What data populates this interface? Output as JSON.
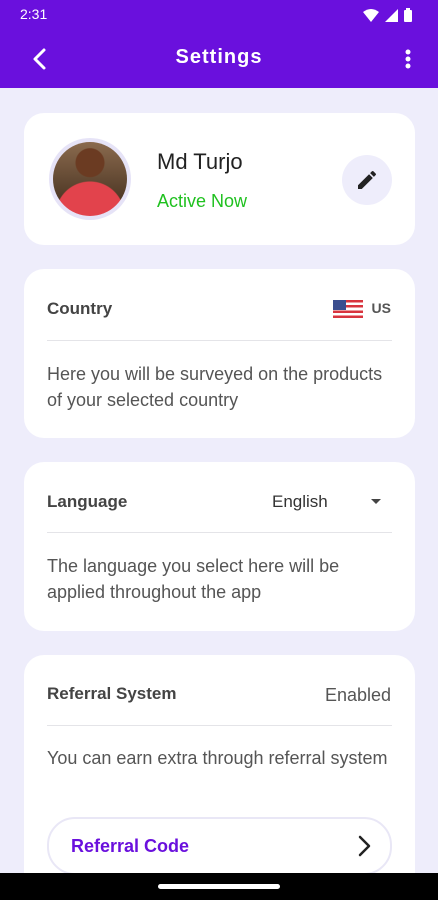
{
  "status_bar": {
    "time": "2:31"
  },
  "app_bar": {
    "title": "Settings"
  },
  "profile": {
    "name": "Md Turjo",
    "status": "Active Now"
  },
  "country": {
    "label": "Country",
    "value": "US",
    "description": "Here you will be surveyed on the products of your selected country"
  },
  "language": {
    "label": "Language",
    "value": "English",
    "description": "The language you select here will be applied throughout the app"
  },
  "referral": {
    "label": "Referral System",
    "value": "Enabled",
    "description": "You can earn extra through referral system",
    "button_label": "Referral Code"
  },
  "colors": {
    "primary": "#6A10DD",
    "active": "#1FC11F",
    "background": "#EEEDFB"
  },
  "icons": [
    "back-arrow-icon",
    "more-vert-icon",
    "pencil-icon",
    "us-flag-icon",
    "dropdown-caret-icon",
    "chevron-right-icon",
    "wifi-icon",
    "signal-icon",
    "battery-icon"
  ]
}
